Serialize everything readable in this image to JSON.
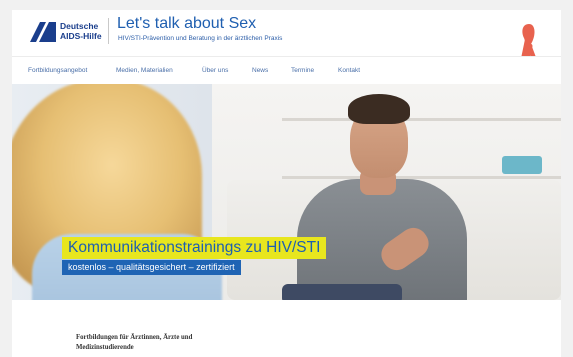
{
  "brand": {
    "logo_line1": "Deutsche",
    "logo_line2": "AIDS-Hilfe",
    "title": "Let's talk about Sex",
    "subtitle": "HIV/STI-Prävention und Beratung in der ärztlichen Praxis",
    "ribbon_icon": "red-ribbon-icon",
    "accent_blue": "#1f64b4",
    "ribbon_color": "#e8624e"
  },
  "nav": {
    "items": [
      {
        "label": "Fortbildungsangebot"
      },
      {
        "label": "Medien, Materialien"
      },
      {
        "label": "Über uns"
      },
      {
        "label": "News"
      },
      {
        "label": "Termine"
      },
      {
        "label": "Kontakt"
      }
    ]
  },
  "hero": {
    "title": "Kommunikationstrainings zu HIV/STI",
    "subtitle": "kostenlos – qualitätsgesichert – zertifiziert",
    "title_bg": "#e8e61e",
    "subtitle_bg": "#1f64b4"
  },
  "intro": {
    "line1": "Fortbildungen für Ärztinnen, Ärzte und",
    "line2": "Medizinstudierende"
  }
}
